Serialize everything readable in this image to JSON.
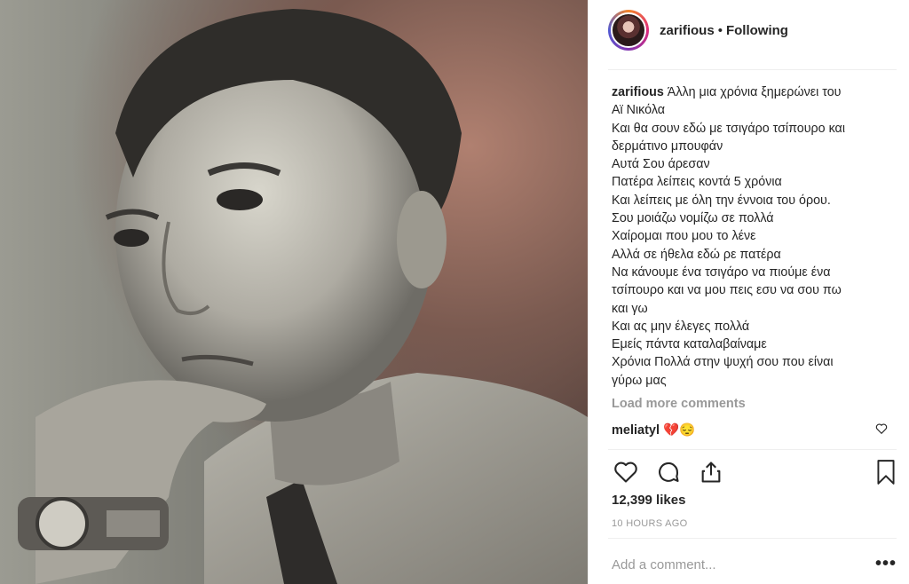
{
  "post": {
    "photo_alt": "",
    "header": {
      "username": "zarifious",
      "separator": "•",
      "follow_status": "Following"
    },
    "caption": {
      "author": "zarifious",
      "lines": [
        "Άλλη μια χρόνια ξημερώνει του",
        "Αϊ Νικόλα",
        "Και θα σουν εδώ με τσιγάρο τσίπουρο και",
        "δερμάτινο μπουφάν",
        "Αυτά Σου άρεσαν",
        "Πατέρα λείπεις κοντά 5 χρόνια",
        "Και λείπεις με όλη την έννοια του όρου.",
        "Σου μοιάζω νομίζω σε πολλά",
        "Χαίρομαι που μου το λένε",
        "Αλλά σε ήθελα εδώ ρε πατέρα",
        "Να κάνουμε ένα τσιγάρο να πιούμε ένα",
        "τσίπουρο και να μου πεις εσυ να σου πω",
        "και γω",
        "Και ας μην έλεγες πολλά",
        "Εμείς πάντα καταλαβαίναμε",
        "Χρόνια Πολλά στην ψυχή σου που είναι",
        "γύρω μας"
      ]
    },
    "load_more_label": "Load more comments",
    "reply": {
      "author": "meliatyl",
      "text": "💔😔"
    },
    "likes": "12,399 likes",
    "timestamp": "10 HOURS AGO",
    "comment_placeholder": "Add a comment...",
    "more_options": "•••",
    "icons": {
      "like": "heart-icon",
      "comment": "comment-bubble-icon",
      "share": "share-icon",
      "save": "bookmark-icon",
      "reply_like": "small-heart-icon"
    },
    "colors": {
      "text": "#262626",
      "muted": "#999999",
      "divider": "#efefef"
    }
  }
}
